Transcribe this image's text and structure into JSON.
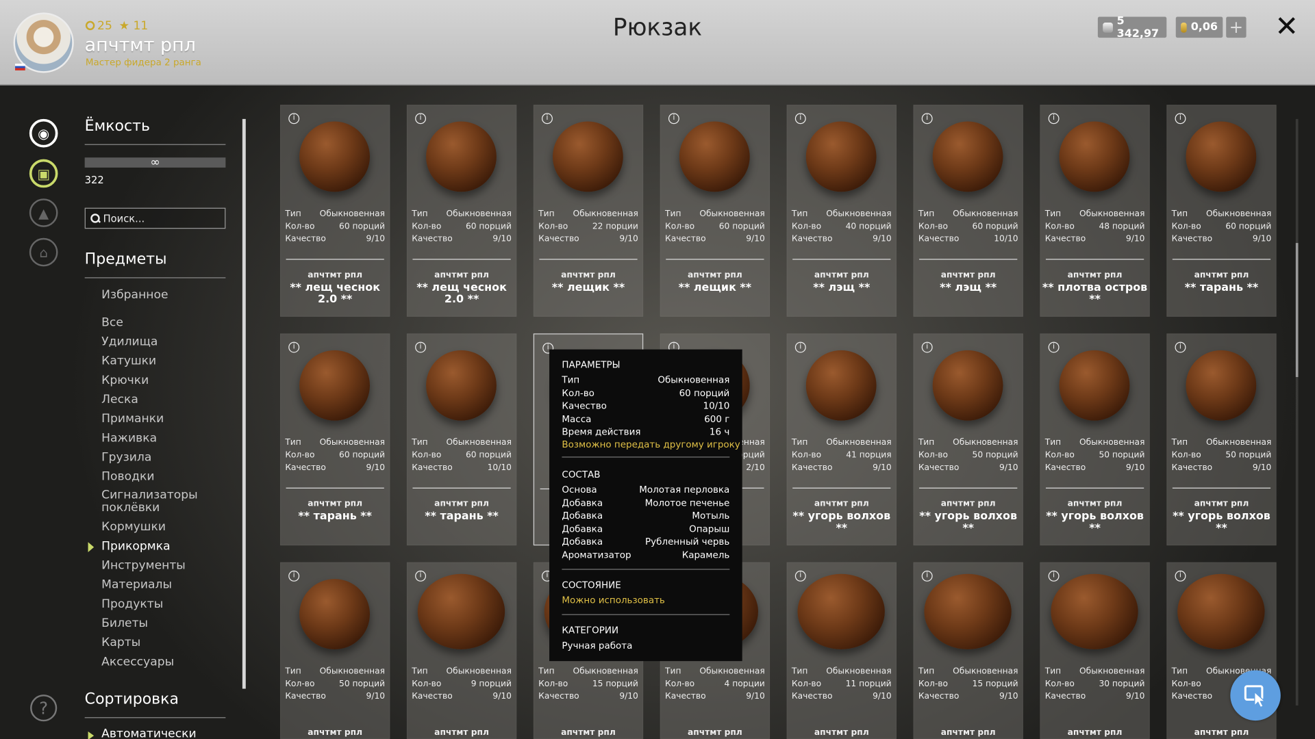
{
  "header": {
    "level": "25",
    "stars": "11",
    "username": "апчтмт рпл",
    "rank": "Мастер фидера 2 ранга",
    "title": "Рюкзак",
    "silver": "5 342,97",
    "gold": "0,06",
    "plus": "+",
    "close": "✕"
  },
  "side": {
    "capacity_title": "Ёмкость",
    "capacity_bar": "∞",
    "capacity_value": "322",
    "search_placeholder": "Поиск...",
    "items_title": "Предметы",
    "favorites": "Избранное",
    "categories": [
      "Все",
      "Удилища",
      "Катушки",
      "Крючки",
      "Леска",
      "Приманки",
      "Наживка",
      "Грузила",
      "Поводки",
      "Сигнализаторы поклёвки",
      "Кормушки",
      "Прикормка",
      "Инструменты",
      "Материалы",
      "Продукты",
      "Билеты",
      "Карты",
      "Аксессуары"
    ],
    "active_category": "Прикормка",
    "sort_title": "Сортировка",
    "sort_value": "Автоматически",
    "help": "?"
  },
  "labels": {
    "type": "Тип",
    "qty": "Кол-во",
    "quality": "Качество",
    "owner": "апчтмт рпл"
  },
  "rows": [
    [
      {
        "type": "Обыкновенная",
        "qty": "60 порций",
        "quality": "9/10",
        "name": "** лещ чеснок 2.0 **"
      },
      {
        "type": "Обыкновенная",
        "qty": "60 порций",
        "quality": "9/10",
        "name": "** лещ чеснок 2.0 **"
      },
      {
        "type": "Обыкновенная",
        "qty": "22 порции",
        "quality": "9/10",
        "name": "** лещик **"
      },
      {
        "type": "Обыкновенная",
        "qty": "60 порций",
        "quality": "9/10",
        "name": "** лещик **"
      },
      {
        "type": "Обыкновенная",
        "qty": "40 порций",
        "quality": "9/10",
        "name": "** лэщ **"
      },
      {
        "type": "Обыкновенная",
        "qty": "60 порций",
        "quality": "10/10",
        "name": "** лэщ **"
      },
      {
        "type": "Обыкновенная",
        "qty": "48 порций",
        "quality": "9/10",
        "name": "** плотва остров **"
      },
      {
        "type": "Обыкновенная",
        "qty": "60 порций",
        "quality": "9/10",
        "name": "** тарань **"
      }
    ],
    [
      {
        "type": "Обыкновенная",
        "qty": "60 порций",
        "quality": "9/10",
        "name": "** тарань **"
      },
      {
        "type": "Обыкновенная",
        "qty": "60 порций",
        "quality": "10/10",
        "name": "** тарань **"
      },
      {
        "type": "",
        "qty": "",
        "quality": "",
        "name": ""
      },
      {
        "type": "енная",
        "qty": "орций",
        "quality": "2/10",
        "name": "*"
      },
      {
        "type": "Обыкновенная",
        "qty": "41 порция",
        "quality": "9/10",
        "name": "** угорь волхов **"
      },
      {
        "type": "Обыкновенная",
        "qty": "50 порций",
        "quality": "9/10",
        "name": "** угорь волхов **"
      },
      {
        "type": "Обыкновенная",
        "qty": "50 порций",
        "quality": "9/10",
        "name": "** угорь волхов **"
      },
      {
        "type": "Обыкновенная",
        "qty": "50 порций",
        "quality": "9/10",
        "name": "** угорь волхов **"
      }
    ],
    [
      {
        "type": "Обыкновенная",
        "qty": "50 порций",
        "quality": "9/10",
        "name": ""
      },
      {
        "type": "Обыкновенная",
        "qty": "9 порций",
        "quality": "9/10",
        "name": ""
      },
      {
        "type": "Обыкновенная",
        "qty": "15 порций",
        "quality": "9/10",
        "name": ""
      },
      {
        "type": "Обыкновенная",
        "qty": "4 порции",
        "quality": "9/10",
        "name": ""
      },
      {
        "type": "Обыкновенная",
        "qty": "11 порций",
        "quality": "9/10",
        "name": ""
      },
      {
        "type": "Обыкновенная",
        "qty": "15 порций",
        "quality": "9/10",
        "name": ""
      },
      {
        "type": "Обыкновенная",
        "qty": "30 порций",
        "quality": "9/10",
        "name": ""
      },
      {
        "type": "Обыкновенная",
        "qty": "",
        "quality": "9/10",
        "name": ""
      }
    ]
  ],
  "tooltip": {
    "params_title": "ПАРАМЕТРЫ",
    "params": [
      [
        "Тип",
        "Обыкновенная"
      ],
      [
        "Кол-во",
        "60 порций"
      ],
      [
        "Качество",
        "10/10"
      ],
      [
        "Масса",
        "600 г"
      ],
      [
        "Время действия",
        "16 ч"
      ]
    ],
    "transfer": "Возможно передать другому игроку",
    "composition_title": "СОСТАВ",
    "composition": [
      [
        "Основа",
        "Молотая перловка"
      ],
      [
        "Добавка",
        "Молотое печенье"
      ],
      [
        "Добавка",
        "Мотыль"
      ],
      [
        "Добавка",
        "Опарыш"
      ],
      [
        "Добавка",
        "Рубленный червь"
      ],
      [
        "Ароматизатор",
        "Карамель"
      ]
    ],
    "state_title": "СОСТОЯНИЕ",
    "state": "Можно использовать",
    "categories_title": "КАТЕГОРИИ",
    "category": "Ручная работа"
  },
  "colors": {
    "accent": "#c9a82a",
    "active_arrow": "#c9d96a",
    "cursor_button": "#5e9ee0"
  }
}
